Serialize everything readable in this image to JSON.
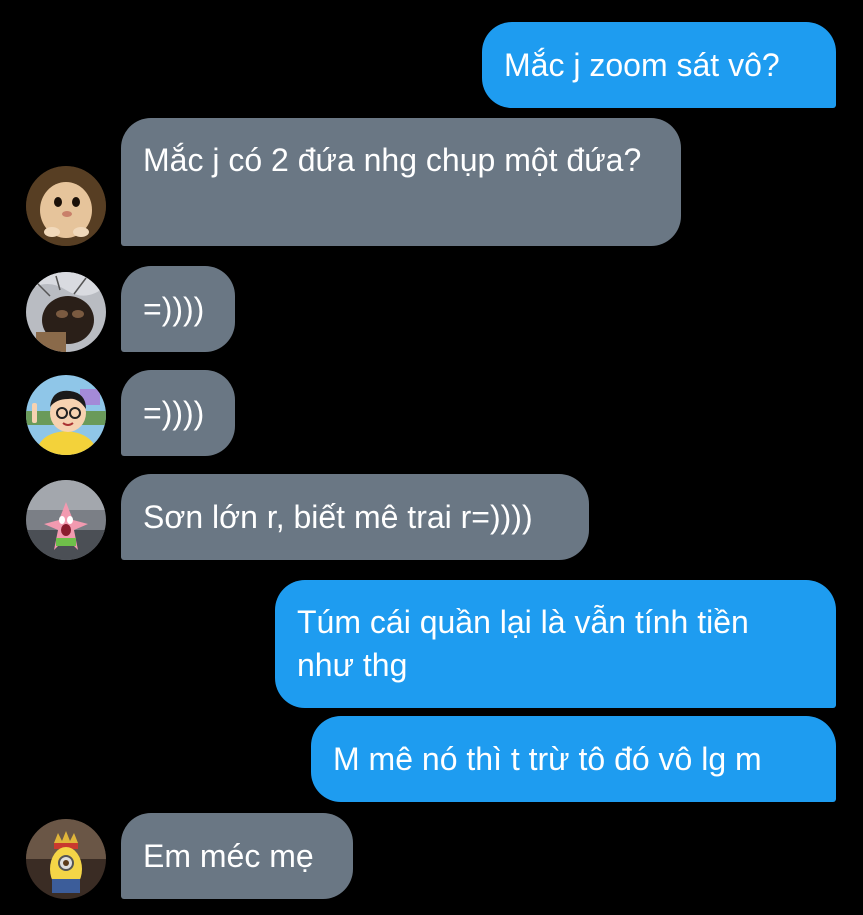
{
  "conversation": {
    "messages": [
      {
        "direction": "outgoing",
        "text": "Mắc j zoom sát vô?"
      },
      {
        "direction": "incoming",
        "text": "Mắc j có 2 đứa nhg chụp một đứa?",
        "avatar": "hamster-avatar"
      },
      {
        "direction": "incoming",
        "text": "=))))",
        "avatar": "masked-face-avatar"
      },
      {
        "direction": "incoming",
        "text": "=))))",
        "avatar": "cartoon-boy-avatar"
      },
      {
        "direction": "incoming",
        "text": "Sơn lớn r, biết mê trai r=))))",
        "avatar": "patrick-star-avatar"
      },
      {
        "direction": "outgoing",
        "text": "Túm cái quần lại là vẫn tính tiền như thg"
      },
      {
        "direction": "outgoing",
        "text": "M mê nó thì t trừ tô đó vô lg m"
      },
      {
        "direction": "incoming",
        "text": "Em méc mẹ",
        "avatar": "minion-king-avatar"
      }
    ]
  },
  "colors": {
    "background": "#000000",
    "outgoing_bubble": "#1e9cf0",
    "incoming_bubble": "#6a7784",
    "text": "#ffffff"
  }
}
